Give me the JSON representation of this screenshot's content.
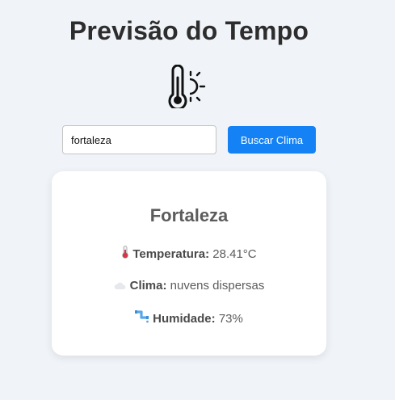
{
  "header": {
    "title": "Previsão do Tempo",
    "icon": "thermometer-sun-icon"
  },
  "search": {
    "value": "fortaleza",
    "button_label": "Buscar Clima"
  },
  "weather": {
    "city": "Fortaleza",
    "temperature": {
      "icon": "thermometer-icon",
      "label": "Temperatura:",
      "value": "28.41°C"
    },
    "condition": {
      "icon": "cloud-icon",
      "label": "Clima:",
      "value": "nuvens dispersas"
    },
    "humidity": {
      "icon": "water-pipe-icon",
      "label": "Humidade:",
      "value": "73%"
    }
  },
  "colors": {
    "background": "#f0f4f8",
    "accent": "#1482f5",
    "card": "#ffffff",
    "text_dark": "#2d2d2d",
    "text_muted": "#5c5c5c"
  }
}
